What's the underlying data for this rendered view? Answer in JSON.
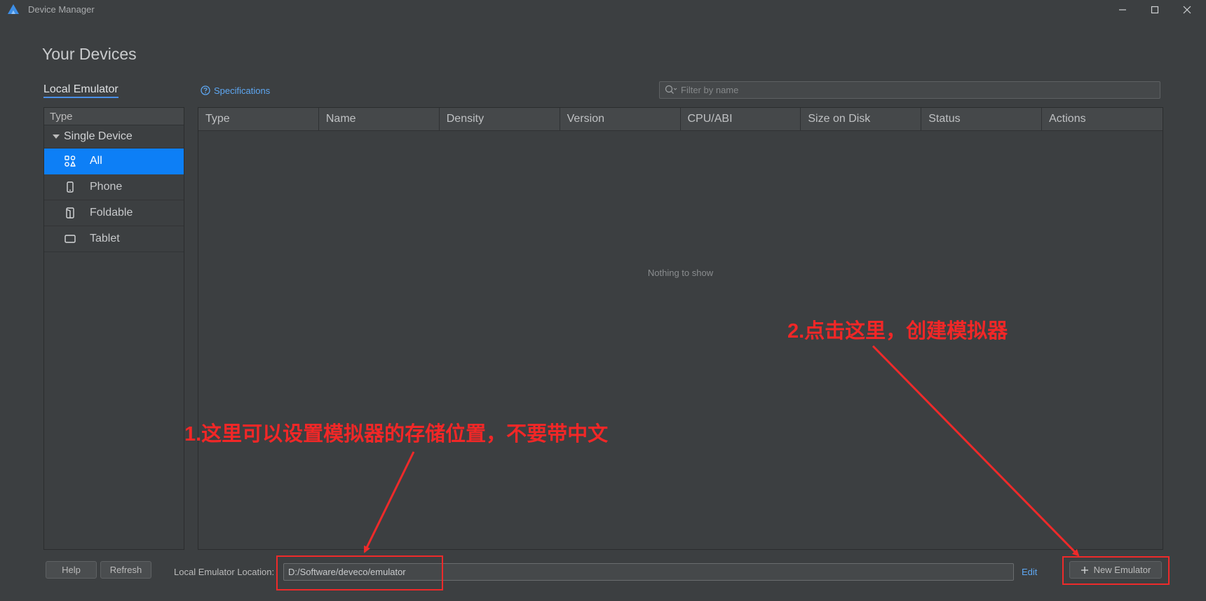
{
  "window": {
    "title": "Device Manager"
  },
  "page": {
    "heading": "Your Devices",
    "tab": "Local Emulator"
  },
  "sidebar": {
    "header": "Type",
    "group": "Single Device",
    "items": [
      {
        "label": "All",
        "icon": "all-categories-icon",
        "active": true
      },
      {
        "label": "Phone",
        "icon": "phone-icon",
        "active": false
      },
      {
        "label": "Foldable",
        "icon": "foldable-icon",
        "active": false
      },
      {
        "label": "Tablet",
        "icon": "tablet-icon",
        "active": false
      }
    ]
  },
  "toolbar": {
    "specifications_link": "Specifications",
    "filter_placeholder": "Filter by name"
  },
  "table": {
    "columns": [
      "Type",
      "Name",
      "Density",
      "Version",
      "CPU/ABI",
      "Size on Disk",
      "Status",
      "Actions"
    ],
    "empty_message": "Nothing to show"
  },
  "footer": {
    "help_label": "Help",
    "refresh_label": "Refresh",
    "location_label": "Local Emulator Location:",
    "location_value": "D:/Software/deveco/emulator",
    "edit_label": "Edit",
    "new_emulator_label": "New Emulator"
  },
  "annotations": {
    "note_1": "1.这里可以设置模拟器的存储位置，不要带中文",
    "note_2": "2.点击这里，创建模拟器",
    "color": "#ee2a2a"
  },
  "colors": {
    "background": "#3c3f41",
    "accent": "#0d7ff6",
    "link": "#5ea7f2"
  }
}
